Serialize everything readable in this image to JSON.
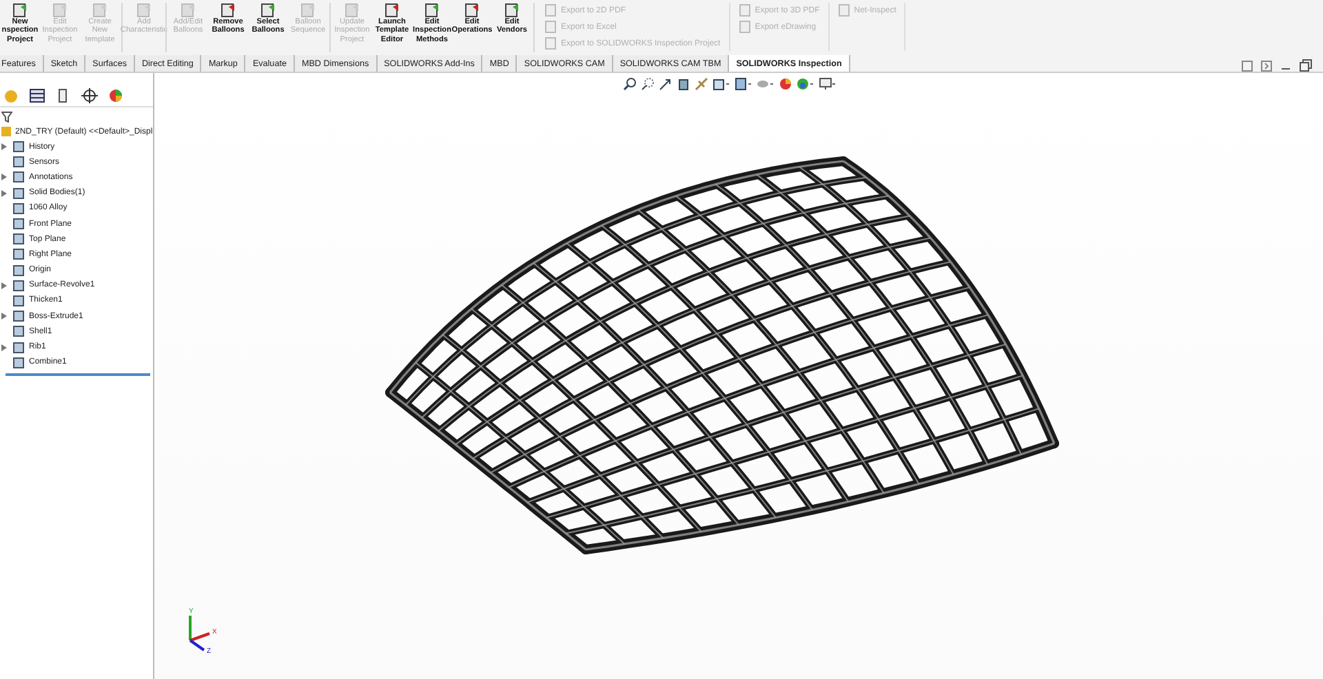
{
  "ribbon": {
    "groups": [
      {
        "buttons": [
          {
            "lines": [
              "New",
              "nspection",
              "Project"
            ],
            "disabled": false
          },
          {
            "lines": [
              "Edit",
              "Inspection",
              "Project"
            ],
            "disabled": true
          },
          {
            "lines": [
              "Create",
              "New",
              "template"
            ],
            "disabled": true
          }
        ]
      },
      {
        "buttons": [
          {
            "lines": [
              "Add",
              "Characteristic"
            ],
            "disabled": true
          }
        ]
      },
      {
        "buttons": [
          {
            "lines": [
              "Add/Edit",
              "Balloons"
            ],
            "disabled": true
          },
          {
            "lines": [
              "Remove",
              "Balloons"
            ],
            "disabled": false
          },
          {
            "lines": [
              "Select",
              "Balloons"
            ],
            "disabled": false
          },
          {
            "lines": [
              "Balloon",
              "Sequence"
            ],
            "disabled": true
          }
        ]
      },
      {
        "buttons": [
          {
            "lines": [
              "Update",
              "Inspection",
              "Project"
            ],
            "disabled": true
          },
          {
            "lines": [
              "Launch",
              "Template",
              "Editor"
            ],
            "disabled": false
          },
          {
            "lines": [
              "Edit",
              "Inspection",
              "Methods"
            ],
            "disabled": false
          },
          {
            "lines": [
              "Edit",
              "Operations"
            ],
            "disabled": false
          },
          {
            "lines": [
              "Edit",
              "Vendors"
            ],
            "disabled": false
          }
        ]
      }
    ],
    "export_columns": [
      [
        {
          "label": "Export to 2D PDF",
          "disabled": true
        },
        {
          "label": "Export to Excel",
          "disabled": true
        },
        {
          "label": "Export to SOLIDWORKS Inspection Project",
          "disabled": true
        }
      ],
      [
        {
          "label": "Export to 3D PDF",
          "disabled": true
        },
        {
          "label": "Export eDrawing",
          "disabled": true
        }
      ],
      [
        {
          "label": "Net-Inspect",
          "disabled": true
        }
      ]
    ]
  },
  "tabs": [
    {
      "label": "Features",
      "selected": false
    },
    {
      "label": "Sketch",
      "selected": false
    },
    {
      "label": "Surfaces",
      "selected": false
    },
    {
      "label": "Direct Editing",
      "selected": false
    },
    {
      "label": "Markup",
      "selected": false
    },
    {
      "label": "Evaluate",
      "selected": false
    },
    {
      "label": "MBD Dimensions",
      "selected": false
    },
    {
      "label": "SOLIDWORKS Add-Ins",
      "selected": false
    },
    {
      "label": "MBD",
      "selected": false
    },
    {
      "label": "SOLIDWORKS CAM",
      "selected": false
    },
    {
      "label": "SOLIDWORKS CAM TBM",
      "selected": false
    },
    {
      "label": "SOLIDWORKS Inspection",
      "selected": true
    }
  ],
  "feature_tree": {
    "root": "2ND_TRY (Default) <<Default>_Displ",
    "items": [
      {
        "label": "History",
        "expandable": true
      },
      {
        "label": "Sensors",
        "expandable": false
      },
      {
        "label": "Annotations",
        "expandable": true
      },
      {
        "label": "Solid Bodies(1)",
        "expandable": true
      },
      {
        "label": "1060 Alloy",
        "expandable": false
      },
      {
        "label": "Front Plane",
        "expandable": false
      },
      {
        "label": "Top Plane",
        "expandable": false
      },
      {
        "label": "Right Plane",
        "expandable": false
      },
      {
        "label": "Origin",
        "expandable": false
      },
      {
        "label": "Surface-Revolve1",
        "expandable": true
      },
      {
        "label": "Thicken1",
        "expandable": false
      },
      {
        "label": "Boss-Extrude1",
        "expandable": true
      },
      {
        "label": "Shell1",
        "expandable": false
      },
      {
        "label": "Rib1",
        "expandable": true
      },
      {
        "label": "Combine1",
        "expandable": false
      }
    ]
  },
  "triad": {
    "x": "X",
    "y": "Y",
    "z": "Z"
  }
}
